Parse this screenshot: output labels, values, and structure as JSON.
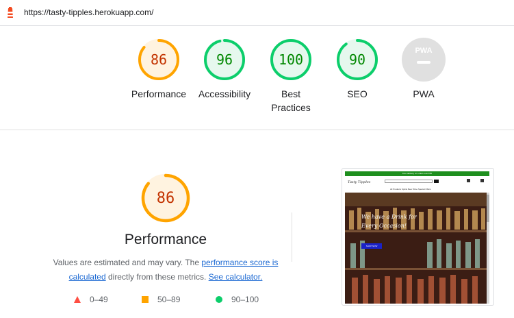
{
  "header": {
    "url": "https://tasty-tipples.herokuapp.com/"
  },
  "colors": {
    "average": "#ffa400",
    "average_text": "#c33300",
    "average_fill": "#fff3e0",
    "pass": "#0cce6b",
    "pass_text": "#008800",
    "pass_fill": "#e6f8ee",
    "pwa_gray": "#e0e0e0",
    "link": "#1967d2",
    "fail": "#ff4e42"
  },
  "categories": [
    {
      "id": "performance",
      "score": 86,
      "label": "Performance",
      "rating": "average"
    },
    {
      "id": "accessibility",
      "score": 96,
      "label": "Accessibility",
      "rating": "pass"
    },
    {
      "id": "best-practices",
      "score": 100,
      "label": "Best Practices",
      "rating": "pass"
    },
    {
      "id": "seo",
      "score": 90,
      "label": "SEO",
      "rating": "pass"
    },
    {
      "id": "pwa",
      "score": null,
      "label": "PWA",
      "badge": "PWA",
      "rating": "na"
    }
  ],
  "performance_detail": {
    "score": "86",
    "title": "Performance",
    "desc_prefix": "Values are estimated and may vary. The ",
    "link_score": "performance score is calculated",
    "desc_middle": " directly from these metrics. ",
    "link_calc": "See calculator.",
    "legend": [
      {
        "shape": "triangle",
        "range": "0–49"
      },
      {
        "shape": "square",
        "range": "50–89"
      },
      {
        "shape": "circle",
        "range": "90–100"
      }
    ]
  },
  "screenshot": {
    "banner": "Free delivery on orders over €50",
    "logo": "Tasty Tipples",
    "menu": "All Products   Spirits   Beer   Wine   Special Offers",
    "hero_text": "We have a Drink for Every Occasion!",
    "button": "SHOP NOW"
  }
}
